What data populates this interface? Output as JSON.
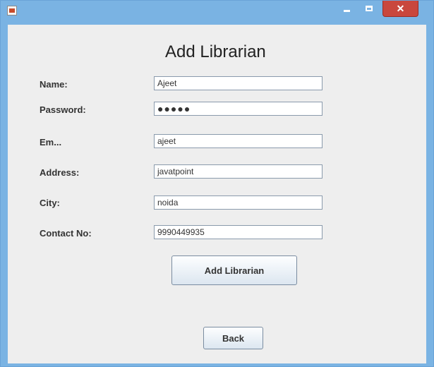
{
  "window": {
    "title": "",
    "close_glyph": "✕",
    "icons": [
      "app-icon",
      "minimize-icon",
      "maximize-icon",
      "close-icon"
    ]
  },
  "form": {
    "title": "Add Librarian",
    "fields": [
      {
        "label": "Name:",
        "value": "Ajeet"
      },
      {
        "label": "Password:",
        "value": "●●●●●"
      },
      {
        "label": "Em...",
        "value": "ajeet"
      },
      {
        "label": "Address:",
        "value": "javatpoint"
      },
      {
        "label": "City:",
        "value": "noida"
      },
      {
        "label": "Contact No:",
        "value": "9990449935"
      }
    ],
    "add_button": "Add Librarian",
    "back_button": "Back"
  },
  "colors": {
    "titlebar": "#7ab3e3",
    "close_button": "#c9473d",
    "panel": "#eeeeee"
  }
}
